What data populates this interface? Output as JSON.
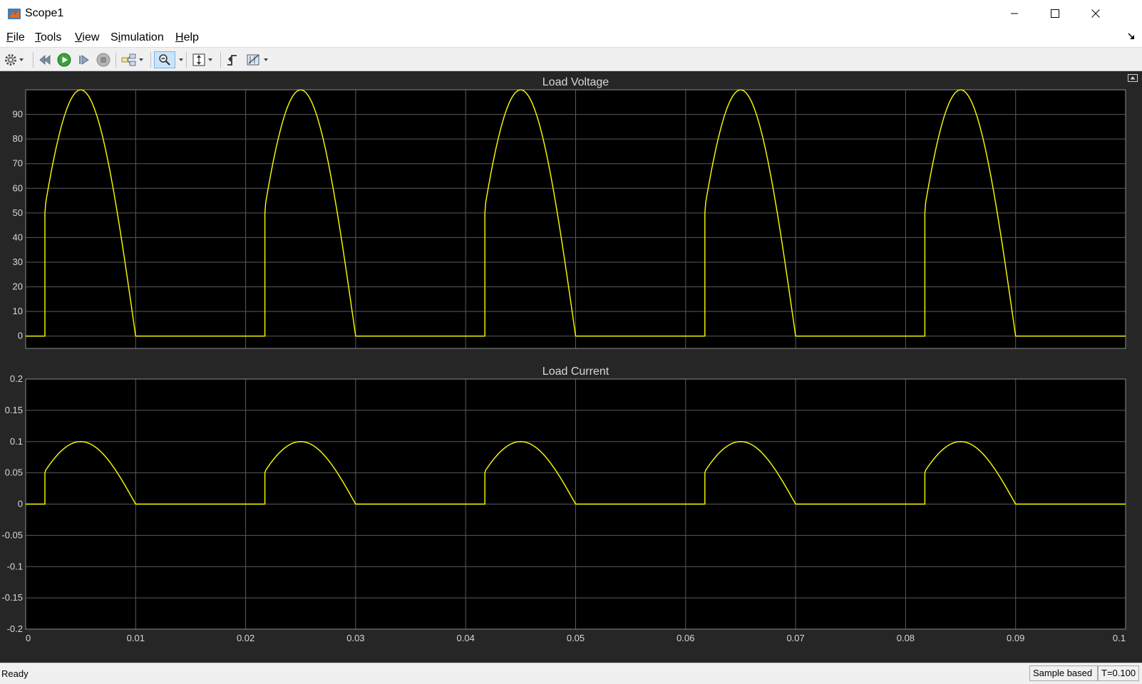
{
  "window": {
    "title": "Scope1",
    "buttons": [
      "minimize",
      "maximize",
      "close"
    ]
  },
  "menu": {
    "items": [
      {
        "label": "File",
        "mnemonic": "F",
        "rest": "ile"
      },
      {
        "label": "Tools",
        "mnemonic": "T",
        "rest": "ools"
      },
      {
        "label": "View",
        "mnemonic": "V",
        "rest": "iew"
      },
      {
        "label": "Simulation",
        "mnemonic": "i",
        "prefix": "S",
        "rest": "mulation"
      },
      {
        "label": "Help",
        "mnemonic": "H",
        "rest": "elp"
      }
    ]
  },
  "toolbar": {
    "items": [
      "gear-icon",
      "step-back-icon",
      "run-icon",
      "step-forward-icon",
      "stop-icon",
      "highlight-block-icon",
      "zoom-icon",
      "scale-axes-icon",
      "triggers-icon",
      "cursor-measurements-icon"
    ]
  },
  "status": {
    "text": "Ready",
    "mode": "Sample based",
    "time": "T=0.100"
  },
  "colors": {
    "plot_bg": "#000000",
    "figure_bg": "#262626",
    "grid": "#5a5a5a",
    "trace": "#ffff00",
    "tick_text": "#d8d8d8"
  },
  "chart_data": [
    {
      "type": "line",
      "title": "Load Voltage",
      "xlabel": "",
      "ylabel": "",
      "xlim": [
        0,
        0.1
      ],
      "ylim": [
        -5,
        100
      ],
      "xticks": [
        0,
        0.01,
        0.02,
        0.03,
        0.04,
        0.05,
        0.06,
        0.07,
        0.08,
        0.09,
        0.1
      ],
      "yticks": [
        0,
        10,
        20,
        30,
        40,
        50,
        60,
        70,
        80,
        90
      ],
      "ytick_labels": [
        "0",
        "10",
        "20",
        "30",
        "40",
        "50",
        "60",
        "70",
        "80",
        "90"
      ],
      "grid": true,
      "series": [
        {
          "color": "#ffff00",
          "x": [
            0,
            0.00175,
            0.00175,
            0.0025,
            0.005,
            0.0075,
            0.01,
            0.02,
            0.02175,
            0.02175,
            0.0225,
            0.025,
            0.0275,
            0.03,
            0.04,
            0.04175,
            0.04175,
            0.0425,
            0.045,
            0.0475,
            0.05,
            0.06,
            0.06175,
            0.06175,
            0.0625,
            0.065,
            0.0675,
            0.07,
            0.08,
            0.08175,
            0.08175,
            0.0825,
            0.085,
            0.0875,
            0.09,
            0.1
          ],
          "y": [
            0,
            0,
            50,
            70.7,
            100,
            70.7,
            0,
            0,
            0,
            50,
            70.7,
            100,
            70.7,
            0,
            0,
            0,
            50,
            70.7,
            100,
            70.7,
            0,
            0,
            0,
            50,
            70.7,
            100,
            70.7,
            0,
            0,
            0,
            50,
            70.7,
            100,
            70.7,
            0,
            0
          ]
        }
      ]
    },
    {
      "type": "line",
      "title": "Load Current",
      "xlabel": "",
      "ylabel": "",
      "xlim": [
        0,
        0.1
      ],
      "ylim": [
        -0.2,
        0.2
      ],
      "xticks": [
        0,
        0.01,
        0.02,
        0.03,
        0.04,
        0.05,
        0.06,
        0.07,
        0.08,
        0.09,
        0.1
      ],
      "xtick_labels": [
        "0",
        "0.01",
        "0.02",
        "0.03",
        "0.04",
        "0.05",
        "0.06",
        "0.07",
        "0.08",
        "0.09",
        "0.1"
      ],
      "yticks": [
        -0.2,
        -0.15,
        -0.1,
        -0.05,
        0,
        0.05,
        0.1,
        0.15,
        0.2
      ],
      "ytick_labels": [
        "-0.2",
        "-0.15",
        "-0.1",
        "-0.05",
        "0",
        "0.05",
        "0.1",
        "0.15",
        "0.2"
      ],
      "grid": true,
      "series": [
        {
          "color": "#ffff00",
          "x": [
            0,
            0.00175,
            0.00175,
            0.0025,
            0.005,
            0.0075,
            0.01,
            0.02,
            0.02175,
            0.02175,
            0.0225,
            0.025,
            0.0275,
            0.03,
            0.04,
            0.04175,
            0.04175,
            0.0425,
            0.045,
            0.0475,
            0.05,
            0.06,
            0.06175,
            0.06175,
            0.0625,
            0.065,
            0.0675,
            0.07,
            0.08,
            0.08175,
            0.08175,
            0.0825,
            0.085,
            0.0875,
            0.09,
            0.1
          ],
          "y": [
            0,
            0,
            0.05,
            0.0707,
            0.1,
            0.0707,
            0,
            0,
            0,
            0.05,
            0.0707,
            0.1,
            0.0707,
            0,
            0,
            0,
            0.05,
            0.0707,
            0.1,
            0.0707,
            0,
            0,
            0,
            0.05,
            0.0707,
            0.1,
            0.0707,
            0,
            0,
            0,
            0.05,
            0.0707,
            0.1,
            0.0707,
            0,
            0
          ]
        }
      ]
    }
  ]
}
